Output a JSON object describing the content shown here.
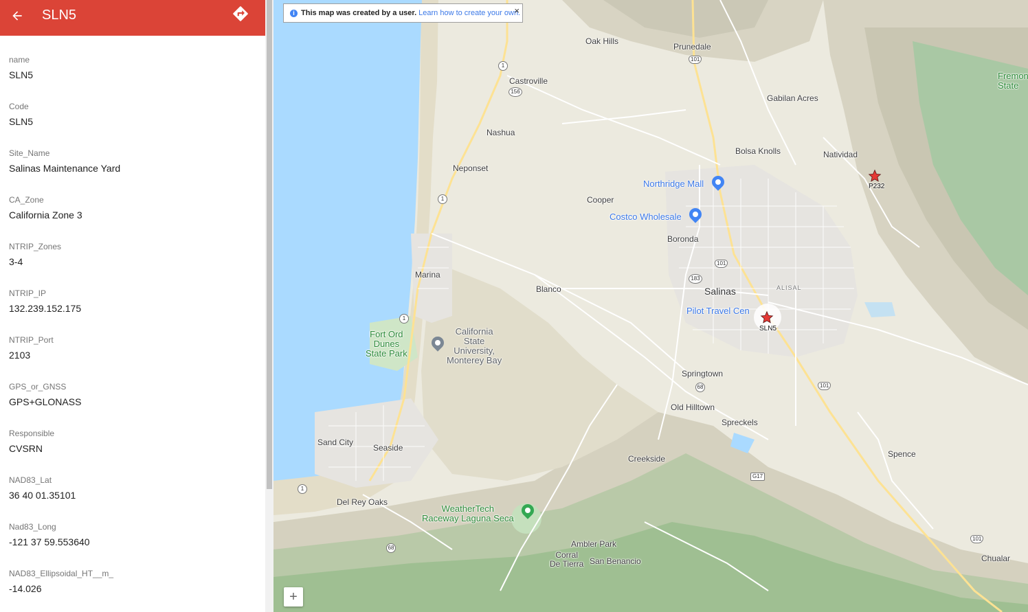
{
  "panel": {
    "title": "SLN5",
    "back_icon": "arrow-back-icon",
    "directions_icon": "directions-icon",
    "header_color": "#db4437",
    "fields": [
      {
        "label": "name",
        "value": "SLN5"
      },
      {
        "label": "Code",
        "value": "SLN5"
      },
      {
        "label": "Site_Name",
        "value": "Salinas Maintenance Yard"
      },
      {
        "label": "CA_Zone",
        "value": "California Zone 3"
      },
      {
        "label": "NTRIP_Zones",
        "value": "3-4"
      },
      {
        "label": "NTRIP_IP",
        "value": "132.239.152.175"
      },
      {
        "label": "NTRIP_Port",
        "value": "2103"
      },
      {
        "label": "GPS_or_GNSS",
        "value": "GPS+GLONASS"
      },
      {
        "label": "Responsible",
        "value": "CVSRN"
      },
      {
        "label": "NAD83_Lat",
        "value": "36 40 01.35101"
      },
      {
        "label": "Nad83_Long",
        "value": "-121 37 59.553640"
      },
      {
        "label": "NAD83_Ellipsoidal_HT__m_",
        "value": "-14.026"
      }
    ]
  },
  "map": {
    "info": {
      "text": "This map was created by a user.",
      "link": "Learn how to create your own.",
      "close": "×"
    },
    "zoom_in": "+",
    "markers": [
      {
        "label": "SLN5",
        "color": "#e53935",
        "selected": true
      },
      {
        "label": "P232",
        "color": "#e53935",
        "selected": false
      }
    ],
    "places": {
      "oak_hills": "Oak Hills",
      "prunedale": "Prunedale",
      "castroville": "Castroville",
      "gabilan_acres": "Gabilan Acres",
      "fremont_state_1": "Fremon",
      "fremont_state_2": "State",
      "nashua": "Nashua",
      "bolsa_knolls": "Bolsa Knolls",
      "natividad": "Natividad",
      "neponset": "Neponset",
      "northridge_mall": "Northridge Mall",
      "cooper": "Cooper",
      "costco": "Costco Wholesale",
      "boronda": "Boronda",
      "marina": "Marina",
      "blanco": "Blanco",
      "salinas": "Salinas",
      "alisal": "ALISAL",
      "pilot_travel": "Pilot Travel Cen",
      "fort_ord": "Fort Ord\nDunes\nState Park",
      "csumb": "California\nState\nUniversity,\nMonterey Bay",
      "springtown": "Springtown",
      "old_hilltown": "Old Hilltown",
      "spreckels": "Spreckels",
      "sand_city": "Sand City",
      "seaside": "Seaside",
      "creekside": "Creekside",
      "spence": "Spence",
      "del_rey_oaks": "Del Rey Oaks",
      "weathertech": "WeatherTech\nRaceway Laguna Seca",
      "ambler_park": "Ambler Park",
      "corral_de_tierra": "Corral\nDe Tierra",
      "san_benancio": "San Benancio",
      "chualar": "Chualar"
    },
    "shields": {
      "r101_a": "101",
      "r1_a": "1",
      "r156": "156",
      "r1_b": "1",
      "r101_b": "101",
      "r183": "183",
      "r1_c": "1",
      "r68_a": "68",
      "r101_c": "101",
      "r1_d": "1",
      "rG17": "G17",
      "r68_b": "68",
      "r101_d": "101"
    },
    "colors": {
      "water": "#aadaff",
      "land": "#eceadf",
      "road": "#ffffff",
      "poi_blue": "#4285f4",
      "park_green": "#34a853"
    }
  }
}
